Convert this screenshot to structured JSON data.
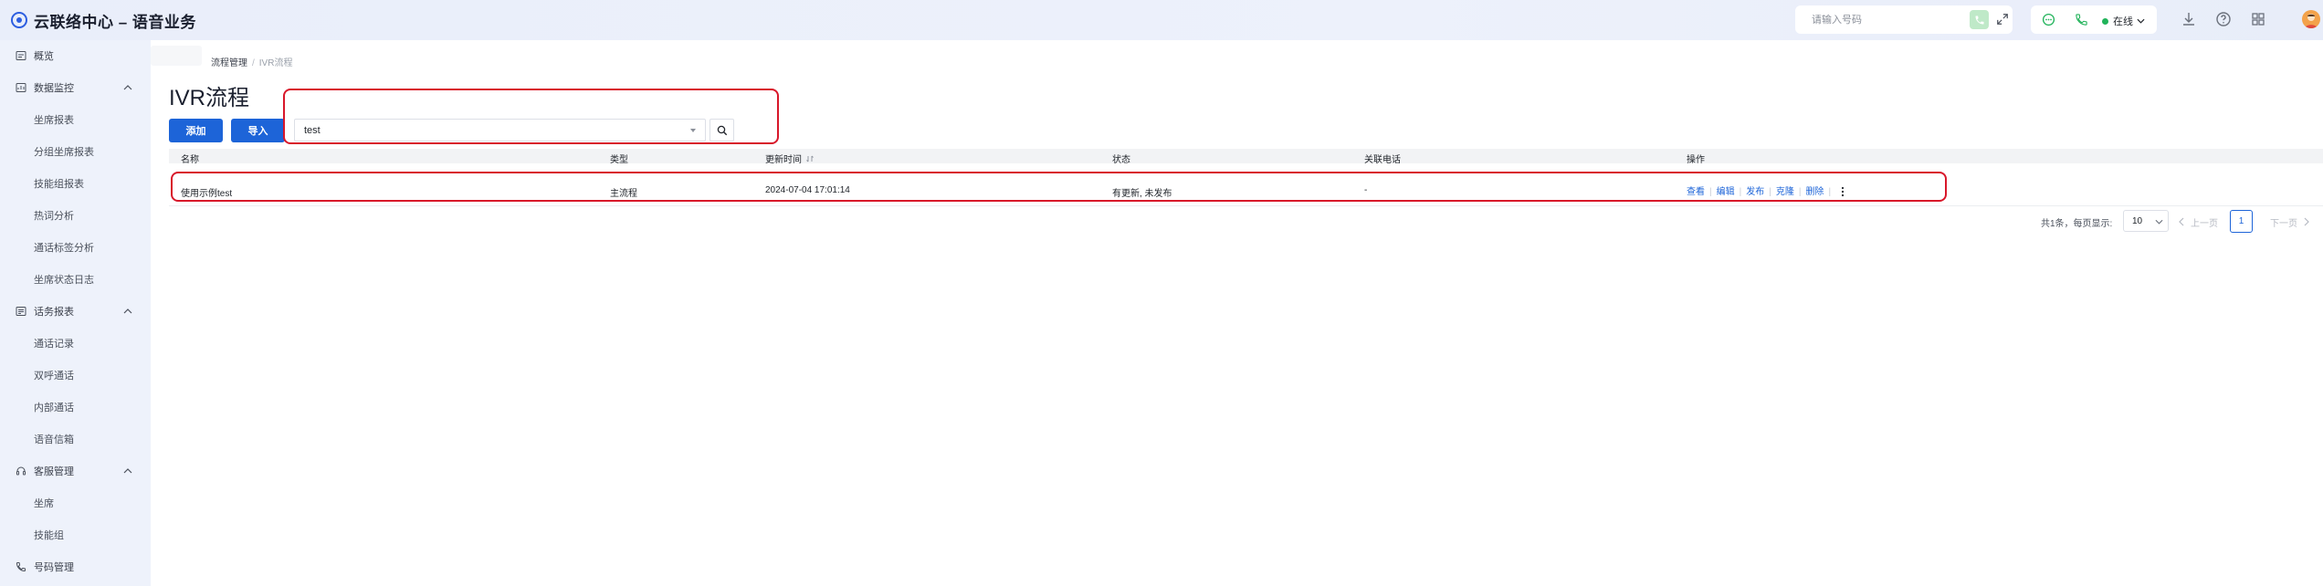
{
  "app": {
    "title": "云联络中心 – 语音业务"
  },
  "topbar": {
    "phone_placeholder": "请输入号码",
    "status_label": "在线",
    "icons": [
      "chat-icon",
      "phone-icon",
      "download-icon",
      "help-icon",
      "grid-icon",
      "avatar"
    ]
  },
  "sidebar": {
    "items": [
      {
        "label": "概览",
        "icon": "overview-icon",
        "type": "item"
      },
      {
        "label": "数据监控",
        "icon": "monitor-icon",
        "type": "group"
      },
      {
        "label": "坐席报表",
        "type": "sub"
      },
      {
        "label": "分组坐席报表",
        "type": "sub"
      },
      {
        "label": "技能组报表",
        "type": "sub"
      },
      {
        "label": "热词分析",
        "type": "sub"
      },
      {
        "label": "通话标签分析",
        "type": "sub"
      },
      {
        "label": "坐席状态日志",
        "type": "sub"
      },
      {
        "label": "话务报表",
        "icon": "report-icon",
        "type": "group"
      },
      {
        "label": "通话记录",
        "type": "sub"
      },
      {
        "label": "双呼通话",
        "type": "sub"
      },
      {
        "label": "内部通话",
        "type": "sub"
      },
      {
        "label": "语音信箱",
        "type": "sub"
      },
      {
        "label": "客服管理",
        "icon": "headset-icon",
        "type": "group"
      },
      {
        "label": "坐席",
        "type": "sub"
      },
      {
        "label": "技能组",
        "type": "sub"
      },
      {
        "label": "号码管理",
        "icon": "phone-number-icon",
        "type": "item"
      }
    ]
  },
  "breadcrumb": {
    "parent": "流程管理",
    "separator": "/",
    "current": "IVR流程"
  },
  "page": {
    "title": "IVR流程"
  },
  "toolbar": {
    "add_label": "添加",
    "import_label": "导入",
    "search_value": "test"
  },
  "table": {
    "columns": [
      "名称",
      "类型",
      "更新时间",
      "状态",
      "关联电话",
      "操作"
    ],
    "rows": [
      {
        "name": "使用示例test",
        "type": "主流程",
        "updated": "2024-07-04 17:01:14",
        "status": "有更新, 未发布",
        "phone": "-",
        "actions": [
          "查看",
          "编辑",
          "发布",
          "克隆",
          "删除"
        ]
      }
    ]
  },
  "pagination": {
    "summary": "共1条，每页显示:",
    "page_size": "10",
    "prev_label": "上一页",
    "current_page": "1",
    "next_label": "下一页"
  },
  "colors": {
    "primary": "#1d64d8",
    "annotation": "#d8172a",
    "online": "#21b35a"
  }
}
